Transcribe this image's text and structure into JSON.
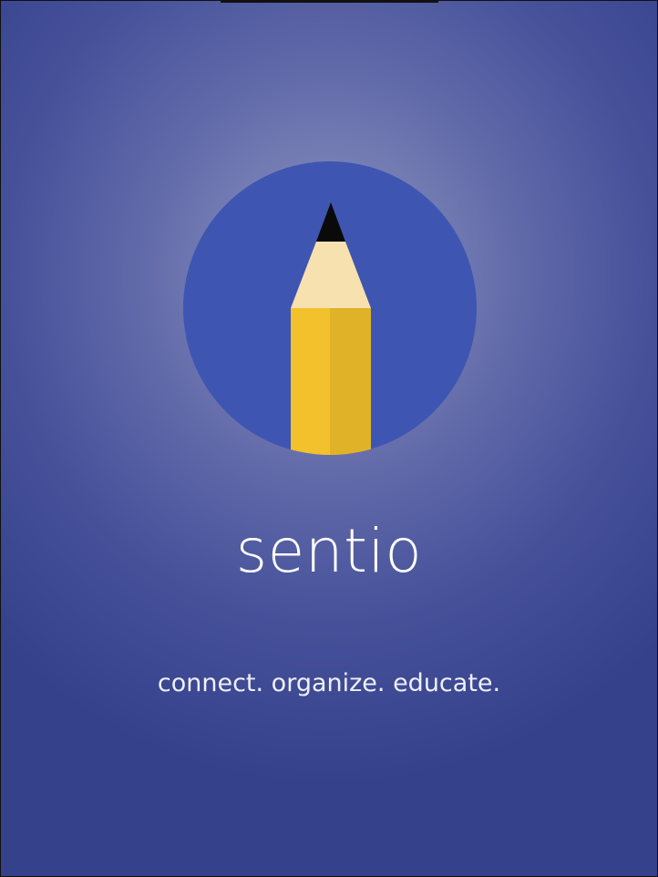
{
  "app": {
    "name": "sentio",
    "tagline": "connect. organize. educate.",
    "logo_icon": "pencil-icon"
  },
  "colors": {
    "background_center": "#8f97c2",
    "background_edge": "#36418c",
    "logo_circle": "#3f55b2",
    "pencil_body": "#f2c12b",
    "pencil_body_shade": "#e0b228",
    "pencil_wood": "#f7e1ae",
    "pencil_lead": "#0a0a0a",
    "text": "#ffffff"
  }
}
